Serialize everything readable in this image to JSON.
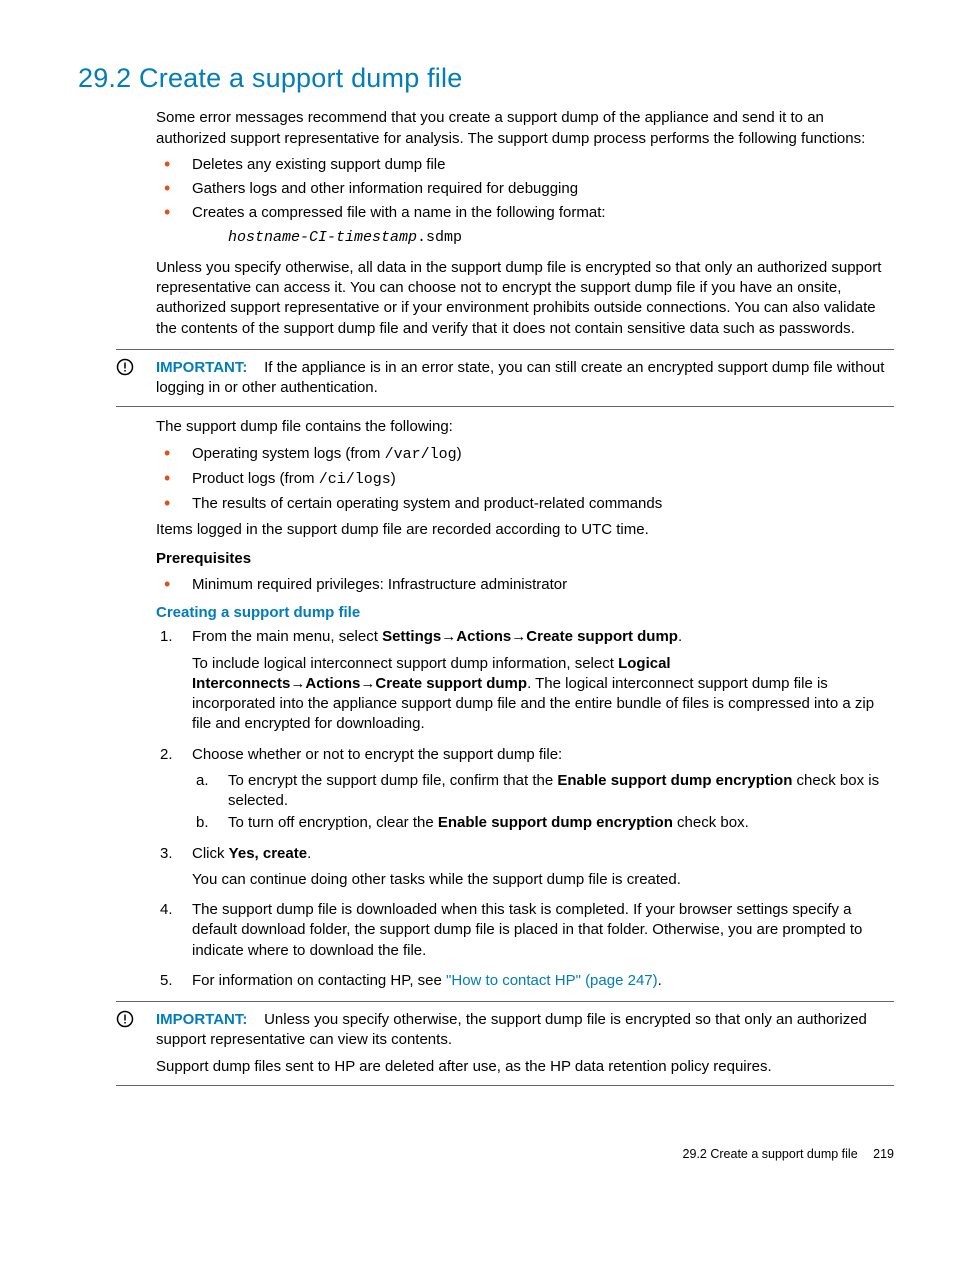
{
  "title": "29.2 Create a support dump file",
  "intro": "Some error messages recommend that you create a support dump of the appliance and send it to an authorized support representative for analysis. The support dump process performs the following functions:",
  "functions": [
    "Deletes any existing support dump file",
    "Gathers logs and other information required for debugging",
    "Creates a compressed file with a name in the following format:"
  ],
  "codeblock_prefix": "hostname-CI-timestamp",
  "codeblock_suffix": ".sdmp",
  "unless": "Unless you specify otherwise, all data in the support dump file is encrypted so that only an authorized support representative can access it. You can choose not to encrypt the support dump file if you have an onsite, authorized support representative or if your environment prohibits outside connections. You can also validate the contents of the support dump file and verify that it does not contain sensitive data such as passwords.",
  "important_label": "IMPORTANT:",
  "important1": "If the appliance is in an error state, you can still create an encrypted support dump file without logging in or other authentication.",
  "contains_intro": "The support dump file contains the following:",
  "contains": {
    "os_prefix": "Operating system logs (from ",
    "os_code": "/var/log",
    "os_suffix": ")",
    "prod_prefix": "Product logs (from ",
    "prod_code": "/ci/logs",
    "prod_suffix": ")",
    "results": "The results of certain operating system and product-related commands"
  },
  "utc": "Items logged in the support dump file are recorded according to UTC time.",
  "prereq_head": "Prerequisites",
  "prereq_item": "Minimum required privileges: Infrastructure administrator",
  "creating_head": "Creating a support dump file",
  "step1": {
    "pre": "From the main menu, select ",
    "b1": "Settings",
    "b2": "Actions",
    "b3": "Create support dump",
    "dot": ".",
    "include_pre": "To include logical interconnect support dump information, select ",
    "lb1": "Logical Interconnects",
    "lb2": "Actions",
    "lb3": "Create support dump",
    "include_post": ". The logical interconnect support dump file is incorporated into the appliance support dump file and the entire bundle of files is compressed into a zip file and encrypted for downloading."
  },
  "step2": {
    "intro": "Choose whether or not to encrypt the support dump file:",
    "a_pre": "To encrypt the support dump file, confirm that the ",
    "a_bold": "Enable support dump encryption",
    "a_post": " check box is selected.",
    "b_pre": "To turn off encryption, clear the ",
    "b_bold": "Enable support dump encryption",
    "b_post": " check box."
  },
  "step3": {
    "pre": "Click ",
    "bold": "Yes, create",
    "dot": ".",
    "after": "You can continue doing other tasks while the support dump file is created."
  },
  "step4": "The support dump file is downloaded when this task is completed. If your browser settings specify a default download folder, the support dump file is placed in that folder. Otherwise, you are prompted to indicate where to download the file.",
  "step5": {
    "pre": "For information on contacting HP, see ",
    "link": "\"How to contact HP\" (page 247)",
    "post": "."
  },
  "important2a": "Unless you specify otherwise, the support dump file is encrypted so that only an authorized support representative can view its contents.",
  "important2b": "Support dump files sent to HP are deleted after use, as the HP data retention policy requires.",
  "footer_text": "29.2 Create a support dump file",
  "footer_page": "219",
  "arrow": "→"
}
